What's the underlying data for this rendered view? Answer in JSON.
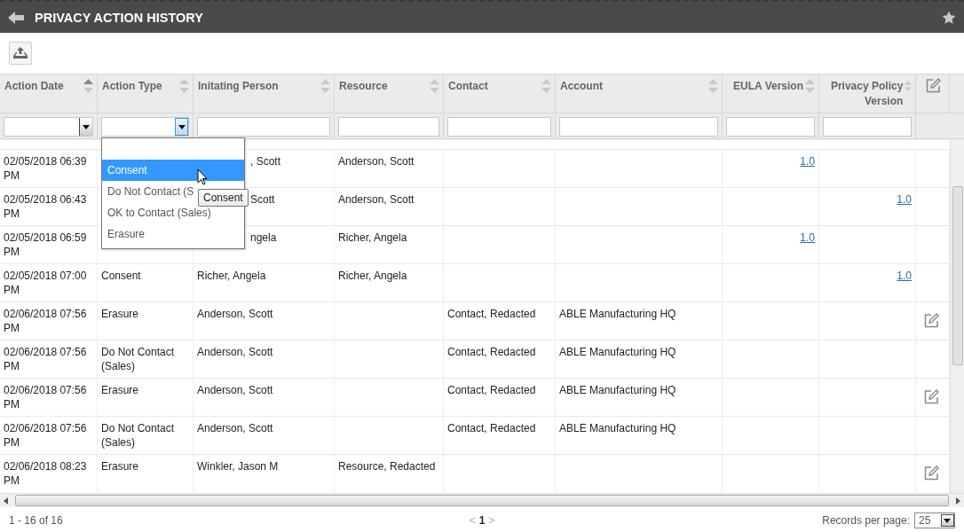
{
  "title": "PRIVACY ACTION HISTORY",
  "columns": [
    {
      "label": "Action Date",
      "sorted": true,
      "right_aligned": false,
      "filter": {
        "kind": "select",
        "open": false
      }
    },
    {
      "label": "Action Type",
      "sorted": false,
      "right_aligned": false,
      "filter": {
        "kind": "select",
        "open": true
      }
    },
    {
      "label": "Initating Person",
      "sorted": false,
      "right_aligned": false,
      "filter": {
        "kind": "text"
      }
    },
    {
      "label": "Resource",
      "sorted": false,
      "right_aligned": false,
      "filter": {
        "kind": "text"
      }
    },
    {
      "label": "Contact",
      "sorted": false,
      "right_aligned": false,
      "filter": {
        "kind": "text"
      }
    },
    {
      "label": "Account",
      "sorted": false,
      "right_aligned": false,
      "filter": {
        "kind": "text"
      }
    },
    {
      "label": "EULA Version",
      "sorted": false,
      "right_aligned": true,
      "filter": {
        "kind": "text"
      }
    },
    {
      "label": "Privacy Policy Version",
      "sorted": false,
      "right_aligned": true,
      "filter": {
        "kind": "text"
      }
    }
  ],
  "rows": [
    {
      "cells": [
        {
          "text": "02/05/2018 06:39 PM",
          "kind": "text"
        },
        null,
        {
          "text": ", Scott",
          "kind": "clipped"
        },
        {
          "text": "Anderson, Scott",
          "kind": "text"
        },
        null,
        null,
        {
          "text": "1.0",
          "kind": "link"
        },
        null
      ],
      "editable": false
    },
    {
      "cells": [
        {
          "text": "02/05/2018 06:43 PM",
          "kind": "text"
        },
        null,
        {
          "text": "Scott",
          "kind": "clipped"
        },
        {
          "text": "Anderson, Scott",
          "kind": "text"
        },
        null,
        null,
        null,
        {
          "text": "1.0",
          "kind": "link"
        }
      ],
      "editable": false
    },
    {
      "cells": [
        {
          "text": "02/05/2018 06:59 PM",
          "kind": "text"
        },
        null,
        {
          "text": "ngela",
          "kind": "clipped"
        },
        {
          "text": "Richer, Angela",
          "kind": "text"
        },
        null,
        null,
        {
          "text": "1.0",
          "kind": "link"
        },
        null
      ],
      "editable": false
    },
    {
      "cells": [
        {
          "text": "02/05/2018 07:00 PM",
          "kind": "text"
        },
        {
          "text": "Consent",
          "kind": "text"
        },
        {
          "text": "Richer, Angela",
          "kind": "text"
        },
        {
          "text": "Richer, Angela",
          "kind": "text"
        },
        null,
        null,
        null,
        {
          "text": "1.0",
          "kind": "link"
        }
      ],
      "editable": false
    },
    {
      "cells": [
        {
          "text": "02/06/2018 07:56 PM",
          "kind": "text"
        },
        {
          "text": "Erasure",
          "kind": "text"
        },
        {
          "text": "Anderson, Scott",
          "kind": "text"
        },
        null,
        {
          "text": "Contact, Redacted",
          "kind": "text"
        },
        {
          "text": "ABLE Manufacturing HQ",
          "kind": "text"
        },
        null,
        null
      ],
      "editable": true
    },
    {
      "cells": [
        {
          "text": "02/06/2018 07:56 PM",
          "kind": "text"
        },
        {
          "text": "Do Not Contact (Sales)",
          "kind": "text"
        },
        {
          "text": "Anderson, Scott",
          "kind": "text"
        },
        null,
        {
          "text": "Contact, Redacted",
          "kind": "text"
        },
        {
          "text": "ABLE Manufacturing HQ",
          "kind": "text"
        },
        null,
        null
      ],
      "editable": false
    },
    {
      "cells": [
        {
          "text": "02/06/2018 07:56 PM",
          "kind": "text"
        },
        {
          "text": "Erasure",
          "kind": "text"
        },
        {
          "text": "Anderson, Scott",
          "kind": "text"
        },
        null,
        {
          "text": "Contact, Redacted",
          "kind": "text"
        },
        {
          "text": "ABLE Manufacturing HQ",
          "kind": "text"
        },
        null,
        null
      ],
      "editable": true
    },
    {
      "cells": [
        {
          "text": "02/06/2018 07:56 PM",
          "kind": "text"
        },
        {
          "text": "Do Not Contact (Sales)",
          "kind": "text"
        },
        {
          "text": "Anderson, Scott",
          "kind": "text"
        },
        null,
        {
          "text": "Contact, Redacted",
          "kind": "text"
        },
        {
          "text": "ABLE Manufacturing HQ",
          "kind": "text"
        },
        null,
        null
      ],
      "editable": false
    },
    {
      "cells": [
        {
          "text": "02/06/2018 08:23 PM",
          "kind": "text"
        },
        {
          "text": "Erasure",
          "kind": "text"
        },
        {
          "text": "Winkler, Jason M",
          "kind": "text"
        },
        {
          "text": "Resource, Redacted",
          "kind": "text"
        },
        null,
        null,
        null,
        null
      ],
      "editable": true
    }
  ],
  "dropdown": {
    "options": [
      {
        "label": "Consent",
        "selected": true
      },
      {
        "label": "Do Not Contact (S",
        "selected": false
      },
      {
        "label": "OK to Contact (Sales)",
        "selected": false
      },
      {
        "label": "Erasure",
        "selected": false
      }
    ],
    "tooltip": "Consent"
  },
  "footer": {
    "range": "1 - 16 of 16",
    "prev": "<",
    "page": "1",
    "next": ">",
    "per_page_label": "Records per page:",
    "per_page": "25"
  }
}
